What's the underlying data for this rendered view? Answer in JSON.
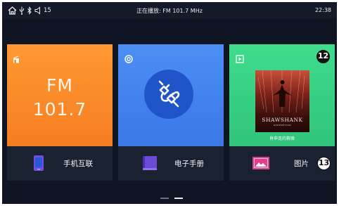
{
  "status_bar": {
    "left_icons": [
      "home-icon",
      "usb-icon",
      "bluetooth-icon",
      "volume-icon"
    ],
    "volume_level": "15",
    "now_playing": "正在播放: FM  101.7  MHz",
    "time": "22:38"
  },
  "cards": {
    "fm": {
      "icon": "radio-icon",
      "band": "FM",
      "frequency": "101.7",
      "color": "#f58a27"
    },
    "bluetooth": {
      "icon": "bluetooth-audio-icon",
      "center_icon": "plug-connector-icon",
      "color": "#4282ee"
    },
    "pictures": {
      "icon": "picture-frame-icon",
      "poster_title": "SHAWSHANK",
      "poster_subtitle": "REDEMPTION",
      "poster_caption": "肖申克的救赎",
      "color": "#38d283",
      "callout": "12"
    }
  },
  "tiles": {
    "phone_link": {
      "icon": "phone-icon",
      "label": "手机互联"
    },
    "ebook": {
      "icon": "book-icon",
      "label": "电子手册"
    },
    "pictures": {
      "icon": "image-icon",
      "label": "图片",
      "callout": "13"
    }
  },
  "pager": {
    "pages": 2,
    "active_page": 2
  }
}
